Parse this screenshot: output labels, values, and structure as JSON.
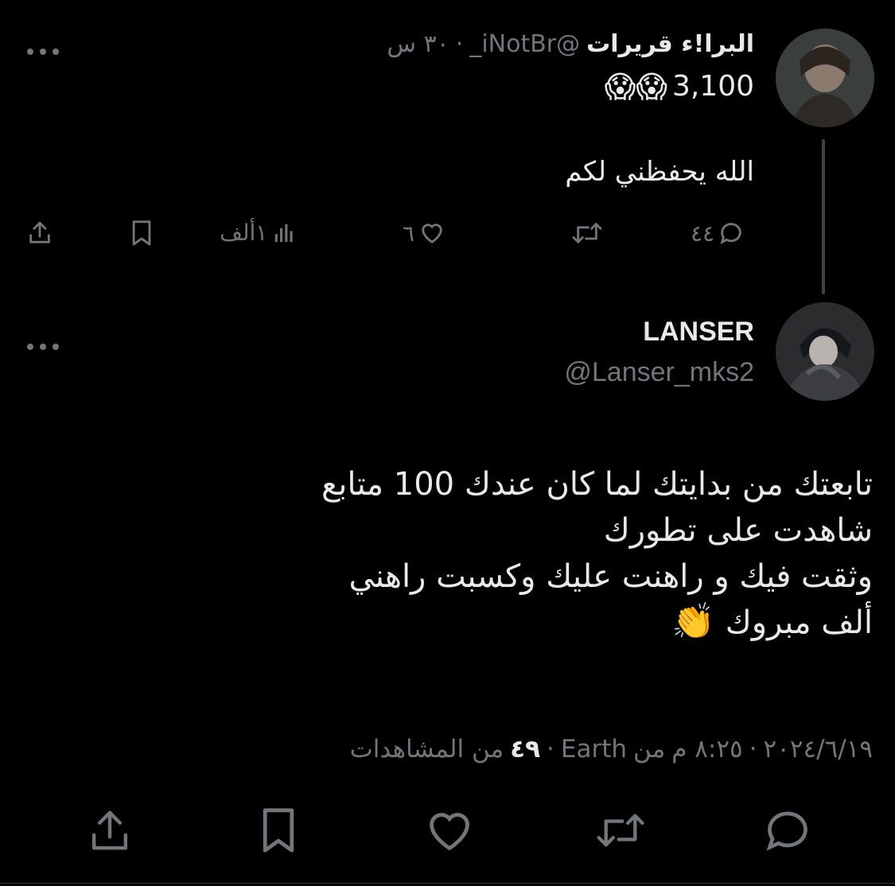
{
  "quoted_tweet": {
    "display_name": "البرا!ء قريرات",
    "handle": "@iNotBr_",
    "time": "٣٠ س",
    "line1_text": "3,100",
    "line1_emojis": "😱😱",
    "text": "الله يحفظني لكم",
    "actions": {
      "replies": "٤٤",
      "retweets": "",
      "likes": "٦",
      "views": "١ألف"
    }
  },
  "main_tweet": {
    "display_name": "LANSER",
    "handle": "@Lanser_mks2",
    "lines": [
      "تابعتك من بدايتك لما كان عندك 100 متابع",
      "شاهدت على تطورك",
      "وثقت فيك و راهنت عليك وكسبت راهني",
      "ألف مبروك"
    ],
    "last_line_emoji": "👏",
    "meta": {
      "date": "٢٠٢٤/٦/١٩",
      "time": "٨:٢٥ م",
      "source_prefix": "من",
      "source": "Earth",
      "views_count": "٤٩",
      "views_label": "من المشاهدات",
      "dot": "·"
    }
  },
  "icons": {
    "more": "more-dots-icon",
    "reply": "reply-bubble-icon",
    "retweet": "retweet-icon",
    "like": "heart-icon",
    "views": "views-bars-icon",
    "bookmark": "bookmark-icon",
    "share": "share-upload-icon"
  },
  "colors": {
    "background": "#000000",
    "text": "#e7e9ea",
    "secondary": "#71767b"
  }
}
